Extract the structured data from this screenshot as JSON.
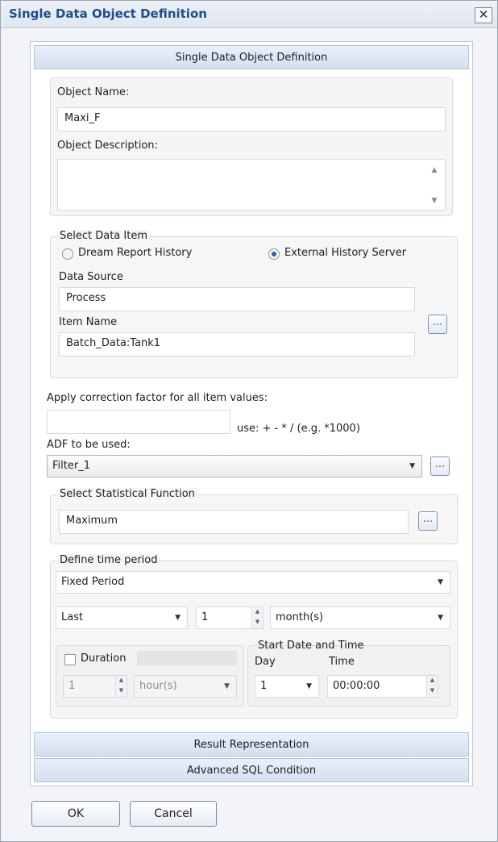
{
  "window": {
    "title": "Single Data Object Definition",
    "close_glyph": "✕"
  },
  "header": {
    "label": "Single Data Object Definition"
  },
  "object": {
    "name_label": "Object Name:",
    "name_value": "Maxi_F",
    "description_label": "Object Description:",
    "description_value": ""
  },
  "data_item": {
    "legend": "Select Data Item",
    "radio_dream": "Dream Report History",
    "radio_external": "External History Server",
    "selected": "External History Server",
    "source_label": "Data Source",
    "source_value": "Process",
    "item_label": "Item Name",
    "item_value": "Batch_Data:Tank1",
    "browse": "..."
  },
  "correction": {
    "label": "Apply correction factor for all item values:",
    "value": "",
    "hint": "use: + - * / (e.g. *1000)"
  },
  "adf": {
    "label": "ADF to be used:",
    "value": "Filter_1",
    "browse": "..."
  },
  "statistical": {
    "legend": "Select Statistical Function",
    "value": "Maximum",
    "browse": "..."
  },
  "time_period": {
    "legend": "Define time period",
    "mode": "Fixed Period",
    "relative": "Last",
    "count": "1",
    "unit": "month(s)",
    "duration_label": "Duration",
    "duration_checked": false,
    "duration_value": "1",
    "duration_unit": "hour(s)",
    "start_legend": "Start Date and Time",
    "day_label": "Day",
    "time_label": "Time",
    "day_value": "1",
    "time_value": "00:00:00"
  },
  "sections": {
    "result": "Result Representation",
    "advanced": "Advanced SQL Condition"
  },
  "buttons": {
    "ok": "OK",
    "cancel": "Cancel"
  },
  "colors": {
    "title": "#1d4f8f",
    "section_band": "#d3e0ef",
    "radio_selected": "#355fa0"
  }
}
